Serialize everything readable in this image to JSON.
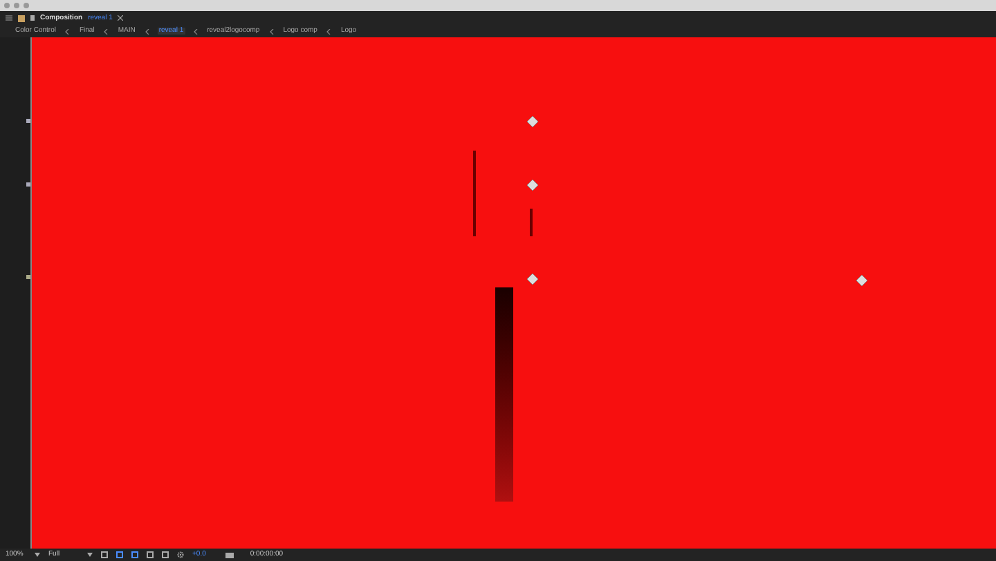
{
  "panel": {
    "label": "Composition",
    "name": "reveal 1"
  },
  "breadcrumbs": [
    {
      "label": "Color Control",
      "selected": false
    },
    {
      "label": "Final",
      "selected": false
    },
    {
      "label": "MAIN",
      "selected": false
    },
    {
      "label": "reveal 1",
      "selected": true
    },
    {
      "label": "reveal2logocomp",
      "selected": false
    },
    {
      "label": "Logo comp",
      "selected": false
    },
    {
      "label": "Logo",
      "selected": false
    }
  ],
  "footer": {
    "zoom": "100%",
    "resolution": "Full",
    "exposure": "+0.0",
    "timecode": "0:00:00:00"
  }
}
